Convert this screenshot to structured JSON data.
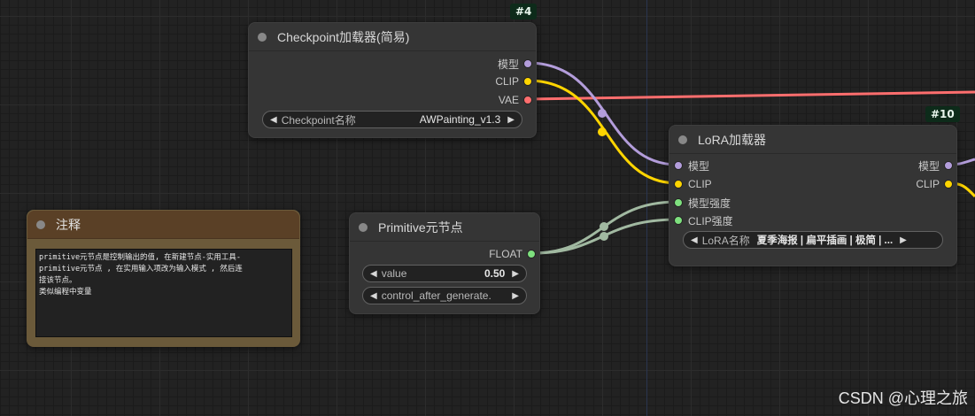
{
  "colors": {
    "model": "#b39ddb",
    "clip": "#ffd500",
    "vae": "#ff6e6e",
    "float": "#a1b9a1",
    "float_slot": "#7ee07e"
  },
  "checkpoint": {
    "id": "#4",
    "title": "Checkpoint加载器(简易)",
    "outputs": [
      "模型",
      "CLIP",
      "VAE"
    ],
    "widget_label": "Checkpoint名称",
    "widget_value": "AWPainting_v1.3"
  },
  "lora": {
    "id": "#10",
    "title": "LoRA加载器",
    "inputs": [
      "模型",
      "CLIP",
      "模型强度",
      "CLIP强度"
    ],
    "outputs": [
      "模型",
      "CLIP"
    ],
    "widget_label": "LoRA名称",
    "widget_value": "夏季海报 | 扁平插画 | 极简 | ..."
  },
  "primitive": {
    "title": "Primitive元节点",
    "output": "FLOAT",
    "value_label": "value",
    "value": "0.50",
    "control_label": "control_after_generate."
  },
  "note": {
    "title": "注释",
    "text": "primitive元节点是控制输出的值, 在新建节点-实用工具-\nprimitive元节点 , 在实用输入项改为输入模式 , 然后连\n接该节点。\n类似编程中变量"
  },
  "watermark": "CSDN @心理之旅"
}
